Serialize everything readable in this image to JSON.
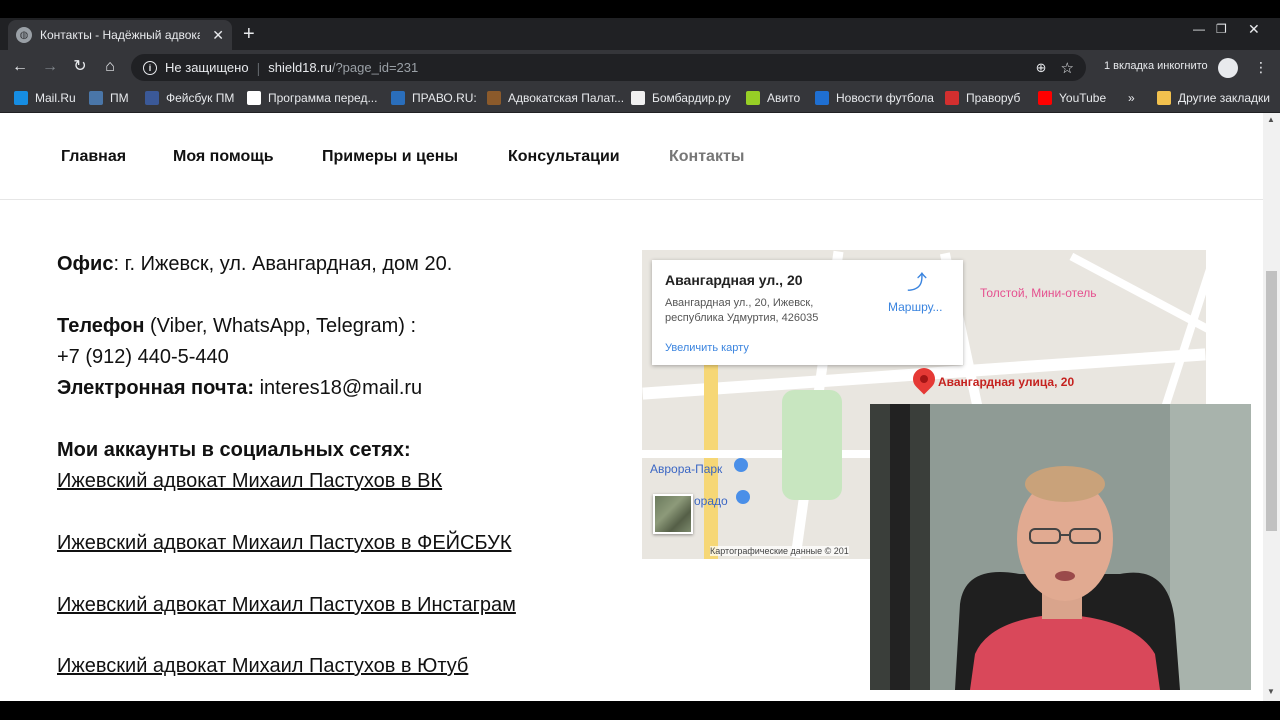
{
  "browser": {
    "tab_title": "Контакты - Надёжный адвокат",
    "url_security": "Не защищено",
    "url_host": "shield18.ru",
    "url_path": "/?page_id=231",
    "incognito_label": "1 вкладка инкогнито",
    "bookmarks": [
      {
        "label": "Mail.Ru",
        "color": "#168de2"
      },
      {
        "label": "ПМ",
        "color": "#4a76a8"
      },
      {
        "label": "Фейсбук ПМ",
        "color": "#3b5998"
      },
      {
        "label": "Программа перед...",
        "color": "#ffffff"
      },
      {
        "label": "ПРАВО.RU:",
        "color": "#2a6ebb"
      },
      {
        "label": "Адвокатская Палат...",
        "color": "#8b5a2b"
      },
      {
        "label": "Бомбардир.ру",
        "color": "#f0f0f0"
      },
      {
        "label": "Авито",
        "color": "#97cf26"
      },
      {
        "label": "Новости футбола",
        "color": "#1f6fd1"
      },
      {
        "label": "Праворуб",
        "color": "#d32f2f"
      },
      {
        "label": "YouTube",
        "color": "#ff0000"
      }
    ],
    "bookmarks_more": "»",
    "other_bookmarks": "Другие закладки"
  },
  "nav": {
    "items": [
      "Главная",
      "Моя помощь",
      "Примеры и цены",
      "Консультации",
      "Контакты"
    ]
  },
  "contacts": {
    "office_label": "Офис",
    "office_value": ": г. Ижевск, ул. Авангардная, дом 20.",
    "phone_label": "Телефон",
    "phone_suffix": " (Viber, WhatsApp, Telegram) :",
    "phone_number": "+7 (912) 440-5-440",
    "email_label": "Электронная почта:",
    "email_value": " interes18@mail.ru",
    "social_heading": "Мои аккаунты в социальных сетях:",
    "social_links": [
      "Ижевский адвокат Михаил Пастухов в ВК",
      "Ижевский адвокат Михаил Пастухов в ФЕЙСБУК",
      "Ижевский адвокат Михаил Пастухов в Инстаграм",
      "Ижевский адвокат Михаил Пастухов в Ютуб"
    ]
  },
  "map": {
    "card_title": "Авангардная ул., 20",
    "card_address": "Авангардная ул., 20, Ижевск, республика Удмуртия, 426035",
    "card_route": "Маршру...",
    "card_enlarge": "Увеличить карту",
    "marker_label": "Авангардная улица, 20",
    "poi_hotel": "Толстой, Мини-отель",
    "poi_park": "Аврора-Парк",
    "poi_dorado": "орадо",
    "copyright": "Картографические данные © 201"
  }
}
